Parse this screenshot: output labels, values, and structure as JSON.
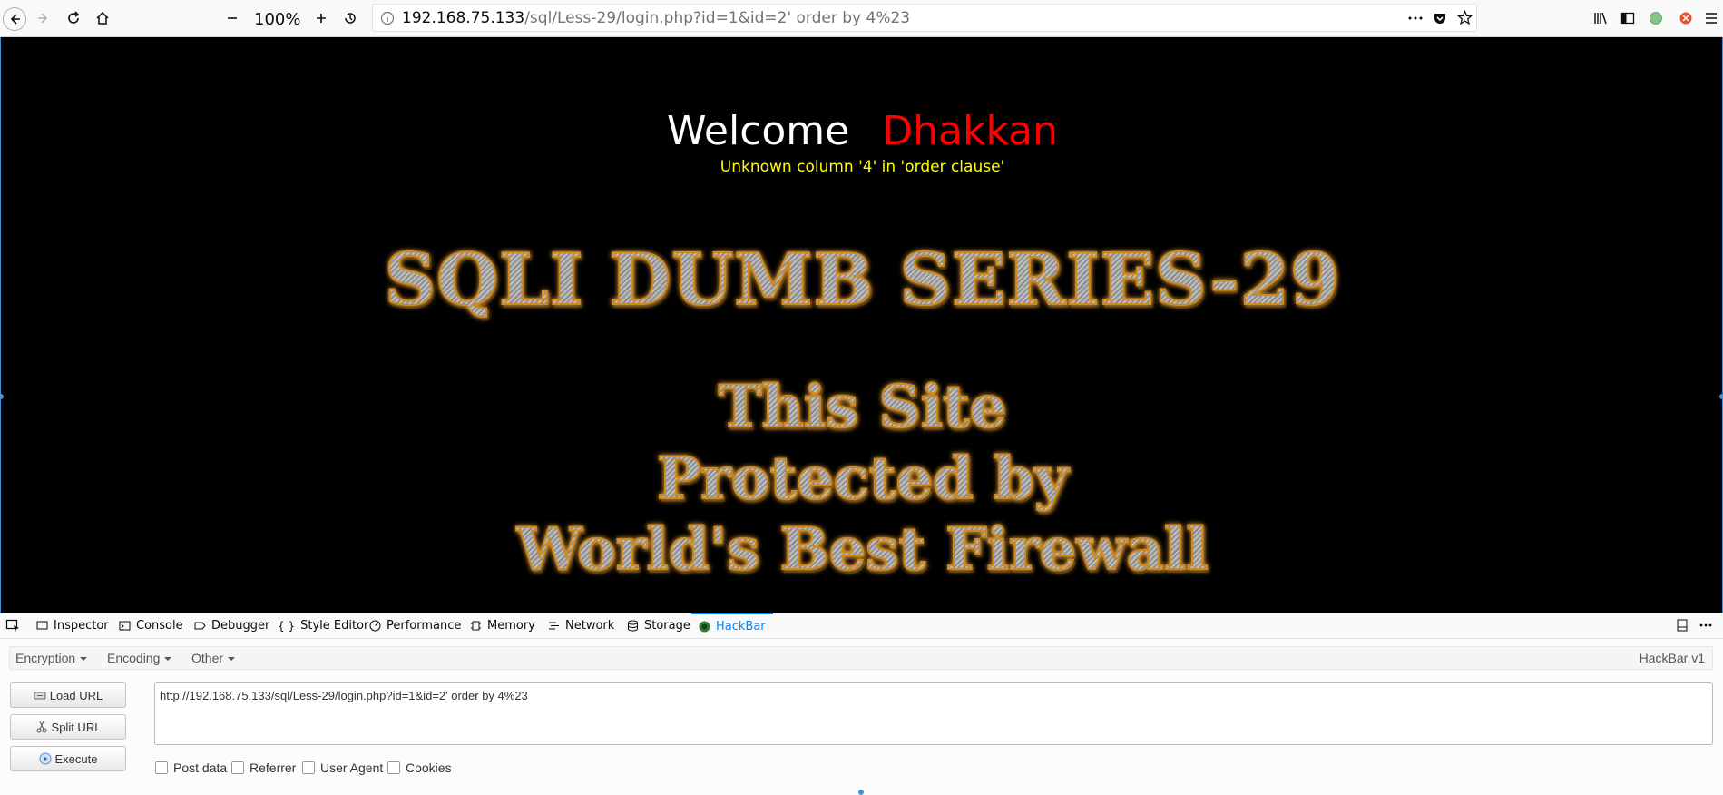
{
  "browser": {
    "zoom": "100%",
    "url_host": "192.168.75.133",
    "url_path": "/sql/Less-29/login.php?id=1&id=2' order by 4%23",
    "icons": [
      "back-icon",
      "forward-icon",
      "reload-icon",
      "home-icon",
      "zoom-out-icon",
      "zoom-in-icon",
      "reset-zoom-icon",
      "info-icon",
      "more-icon",
      "pocket-icon",
      "bookmark-star-icon",
      "library-icon",
      "sidebar-icon",
      "extension-green-icon",
      "extension-red-icon",
      "menu-icon"
    ]
  },
  "page": {
    "welcome_word": "Welcome",
    "welcome_name": "Dhakkan",
    "error_message": "Unknown column '4' in 'order clause'",
    "series_title": "SQLI DUMB SERIES-29",
    "banner_line1": "This Site",
    "banner_line2": "Protected by",
    "banner_line3": "World's Best Firewall",
    "colors": {
      "background": "#000000",
      "welcome": "#ffffff",
      "name": "#ff0000",
      "error": "#ffff00",
      "title_glow": "#f0a030"
    }
  },
  "devtools": {
    "tabs": [
      "Inspector",
      "Console",
      "Debugger",
      "Style Editor",
      "Performance",
      "Memory",
      "Network",
      "Storage",
      "HackBar"
    ],
    "active_tab": "HackBar",
    "accent": "#0a84ff"
  },
  "hackbar": {
    "menus": [
      "Encryption",
      "Encoding",
      "Other"
    ],
    "version": "HackBar v1",
    "buttons": {
      "load": "Load URL",
      "split": "Split URL",
      "execute": "Execute"
    },
    "url_value": "http://192.168.75.133/sql/Less-29/login.php?id=1&id=2' order by 4%23",
    "checkboxes": [
      "Post data",
      "Referrer",
      "User Agent",
      "Cookies"
    ]
  }
}
